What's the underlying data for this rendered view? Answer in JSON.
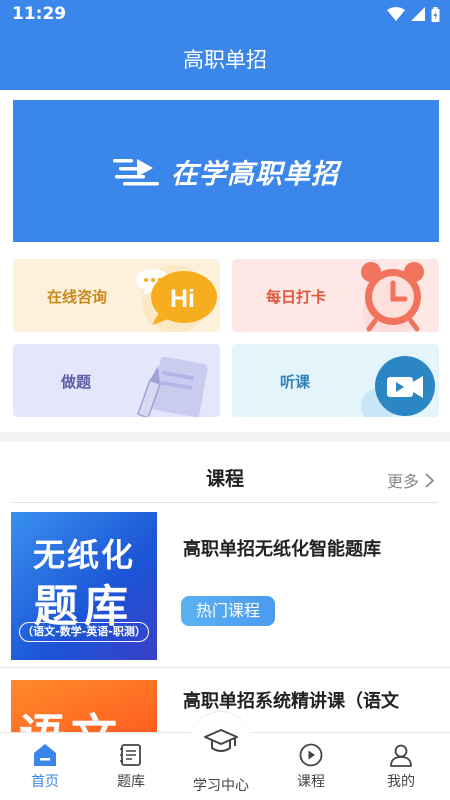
{
  "status_bar": {
    "time": "11:29"
  },
  "header": {
    "title": "高职单招"
  },
  "banner": {
    "text": "在学高职单招"
  },
  "quick_tiles": [
    {
      "label": "在线咨询",
      "icon": "chat-bubble-hi-icon",
      "icon_text": "Hi"
    },
    {
      "label": "每日打卡",
      "icon": "alarm-clock-icon"
    },
    {
      "label": "做题",
      "icon": "pen-paper-icon"
    },
    {
      "label": "听课",
      "icon": "video-camera-icon"
    }
  ],
  "courses_section": {
    "title": "课程",
    "more": "更多",
    "items": [
      {
        "name": "高职单招无纸化智能题库",
        "tag": "热门课程",
        "thumb_line1": "无纸化",
        "thumb_line2": "题库",
        "thumb_subjects": "（语文-数学-英语-职测）"
      },
      {
        "name": "高职单招系统精讲课（语文",
        "thumb_line1": "语文"
      }
    ]
  },
  "tab_bar": {
    "tabs": [
      {
        "label": "首页",
        "icon": "home-icon",
        "active": true
      },
      {
        "label": "题库",
        "icon": "question-bank-icon",
        "active": false
      },
      {
        "label": "学习中心",
        "icon": "graduation-cap-icon",
        "active": false
      },
      {
        "label": "课程",
        "icon": "play-circle-icon",
        "active": false
      },
      {
        "label": "我的",
        "icon": "user-icon",
        "active": false
      }
    ]
  },
  "colors": {
    "primary": "#3b86ea",
    "tab_active": "#3b86ea",
    "tag_blue": "#4c9af0"
  }
}
